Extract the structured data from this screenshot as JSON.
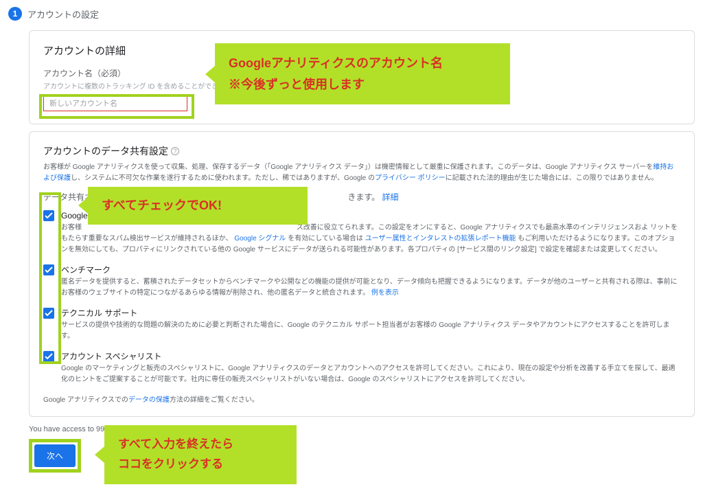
{
  "step": {
    "num": "1",
    "title": "アカウントの設定"
  },
  "card1": {
    "title": "アカウントの詳細",
    "account_label": "アカウント名（必須）",
    "account_sub": "アカウントに複数のトラッキング ID を含めることができます",
    "account_placeholder": "新しいアカウント名"
  },
  "callout1": {
    "line1": "Googleアナリティクスのアカウント名",
    "line2": "※今後ずっと使用します"
  },
  "card2": {
    "title": "アカウントのデータ共有設定",
    "desc_pre": "お客様が Google アナリティクスを使って収集、処理、保存するデータ（「Google アナリティクス データ」）は機密情報として厳重に保護されます。このデータは、Google アナリティクス サーバーを",
    "link1": "維持および保護",
    "desc_mid": "し、システムに不可欠な作業を遂行するために使われます。ただし、稀ではありますが、Google の",
    "link2": "プライバシー ポリシー",
    "desc_post": "に記載された法的理由が生じた場合には、この限りではありません。",
    "share_opts_label": "データ共有オプション",
    "share_opts_end": "きます。",
    "link_detail": "詳細",
    "opt1": {
      "title": "Google の",
      "desc_a": "お客様",
      "desc_b": "ス改善に役立てられます。この設定をオンにすると、Google アナリティクスでも最高水準のインテリジェンスおよ",
      "desc_c": "リットをもたらす重要なスパム検出サービスが維持されるほか、",
      "link_sig": "Google シグナル",
      "desc_d": "を有効にしている場合は",
      "link_user": "ユーザー属性とインタレストの拡張レポート機能",
      "desc_e": "もご利用いただけるようになります。このオプションを無効にしても、プロパティにリンクされている他の Google サービスにデータが送られる可能性があります。各プロパティの [サービス間のリンク設定] で設定を確認または変更してください。"
    },
    "opt2": {
      "title": "ベンチマーク",
      "desc": "匿名データを提供すると、蓄積されたデータセットからベンチマークや公開などの機能の提供が可能となり、データ傾向も把握できるようになります。データが他のユーザーと共有される際は、事前にお客様のウェブサイトの特定につながるあらゆる情報が削除され、他の匿名データと統合されます。 ",
      "link": "例を表示"
    },
    "opt3": {
      "title": "テクニカル サポート",
      "desc": "サービスの提供や技術的な問題の解決のために必要と判断された場合に、Google のテクニカル サポート担当者がお客様の Google アナリティクス データやアカウントにアクセスすることを許可します。"
    },
    "opt4": {
      "title": "アカウント スペシャリスト",
      "desc": "Google のマーケティングと販売のスペシャリストに、Google アナリティクスのデータとアカウントへのアクセスを許可してください。これにより、現在の設定や分析を改善する手立てを探して、最適化のヒントをご提案することが可能です。社内に専任の販売スペシャリストがいない場合は、Google のスペシャリストにアクセスを許可してください。"
    },
    "foot_pre": "Google アナリティクスでの",
    "foot_link": "データの保護",
    "foot_post": "方法の詳細をご覧ください。"
  },
  "callout2": "すべてチェックでOK!",
  "access": "You have access to 99 a",
  "next": "次へ",
  "callout3": {
    "line1": "すべて入力を終えたら",
    "line2": "ココをクリックする"
  }
}
